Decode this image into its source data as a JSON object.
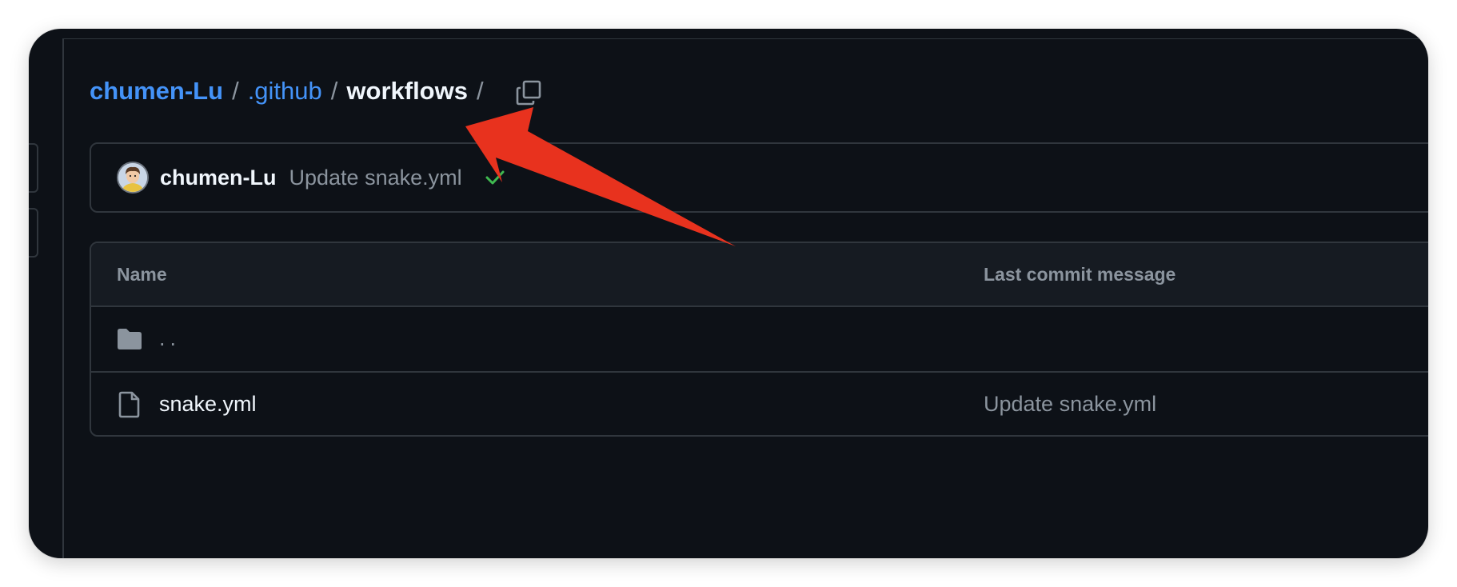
{
  "breadcrumb": {
    "owner": "chumen-Lu",
    "folder": ".github",
    "current": "workflows",
    "separator": "/",
    "copy_icon": "copy-icon"
  },
  "latest_commit": {
    "author": "chumen-Lu",
    "message": "Update snake.yml",
    "status_icon": "check-icon",
    "status_color": "#3fb950"
  },
  "file_table": {
    "columns": [
      "Name",
      "Last commit message"
    ],
    "rows": [
      {
        "icon": "folder-icon",
        "name": "..",
        "message": ""
      },
      {
        "icon": "file-icon",
        "name": "snake.yml",
        "message": "Update snake.yml"
      }
    ]
  },
  "annotation": {
    "icon": "arrow-pointer",
    "color": "#e8321e"
  },
  "colors": {
    "background": "#0d1117",
    "link": "#4493f8",
    "border": "#30363d",
    "muted_text": "#8b949e",
    "primary_text": "#f0f6fc"
  }
}
